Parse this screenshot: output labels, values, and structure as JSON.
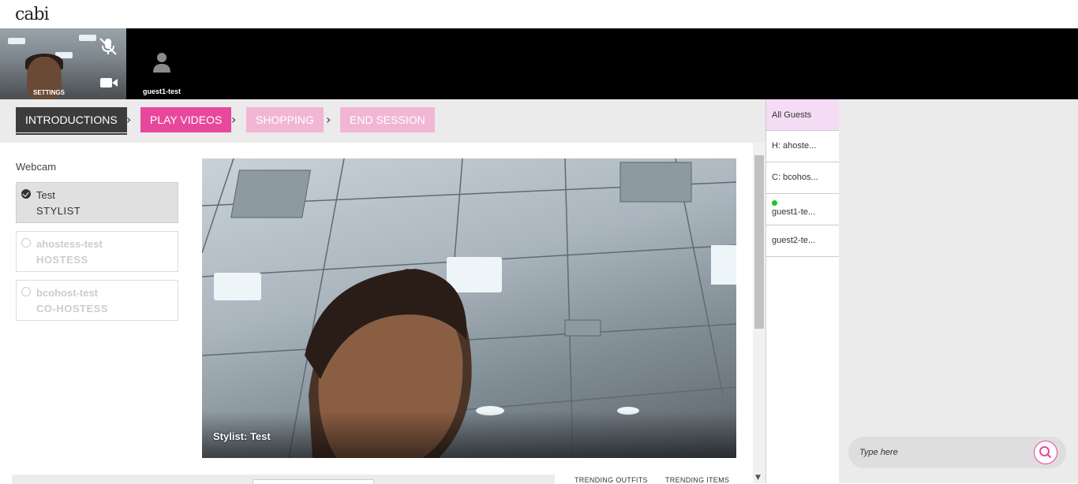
{
  "app": {
    "logo": "cabi"
  },
  "videobar": {
    "self": {
      "settings_label": "SETTINGS"
    },
    "guest_tile": {
      "name": "guest1-test"
    }
  },
  "steps": [
    {
      "label": "INTRODUCTIONS",
      "state": "active"
    },
    {
      "label": "PLAY VIDEOS",
      "state": "enabled"
    },
    {
      "label": "SHOPPING",
      "state": "disabled"
    },
    {
      "label": "END SESSION",
      "state": "disabled"
    }
  ],
  "webcam": {
    "label": "Webcam",
    "people": [
      {
        "name": "Test",
        "role": "STYLIST",
        "selected": true
      },
      {
        "name": "ahostess-test",
        "role": "HOSTESS",
        "selected": false
      },
      {
        "name": "bcohost-test",
        "role": "CO-HOSTESS",
        "selected": false
      }
    ]
  },
  "stage": {
    "caption": "Stylist: Test"
  },
  "trending": {
    "outfits": "TRENDING OUTFITS",
    "items": "TRENDING ITEMS"
  },
  "guests": [
    {
      "label": "All Guests"
    },
    {
      "label": "H: ahoste..."
    },
    {
      "label": "C: bcohos..."
    },
    {
      "label": "guest1-te...",
      "online": true
    },
    {
      "label": "guest2-te..."
    }
  ],
  "chat": {
    "placeholder": "Type here"
  },
  "colors": {
    "accent": "#e8489b",
    "accent_light": "#f2b6d4",
    "dark": "#3c3c3c",
    "online": "#22c322",
    "selected_guest_bg": "#f5dcf5"
  }
}
